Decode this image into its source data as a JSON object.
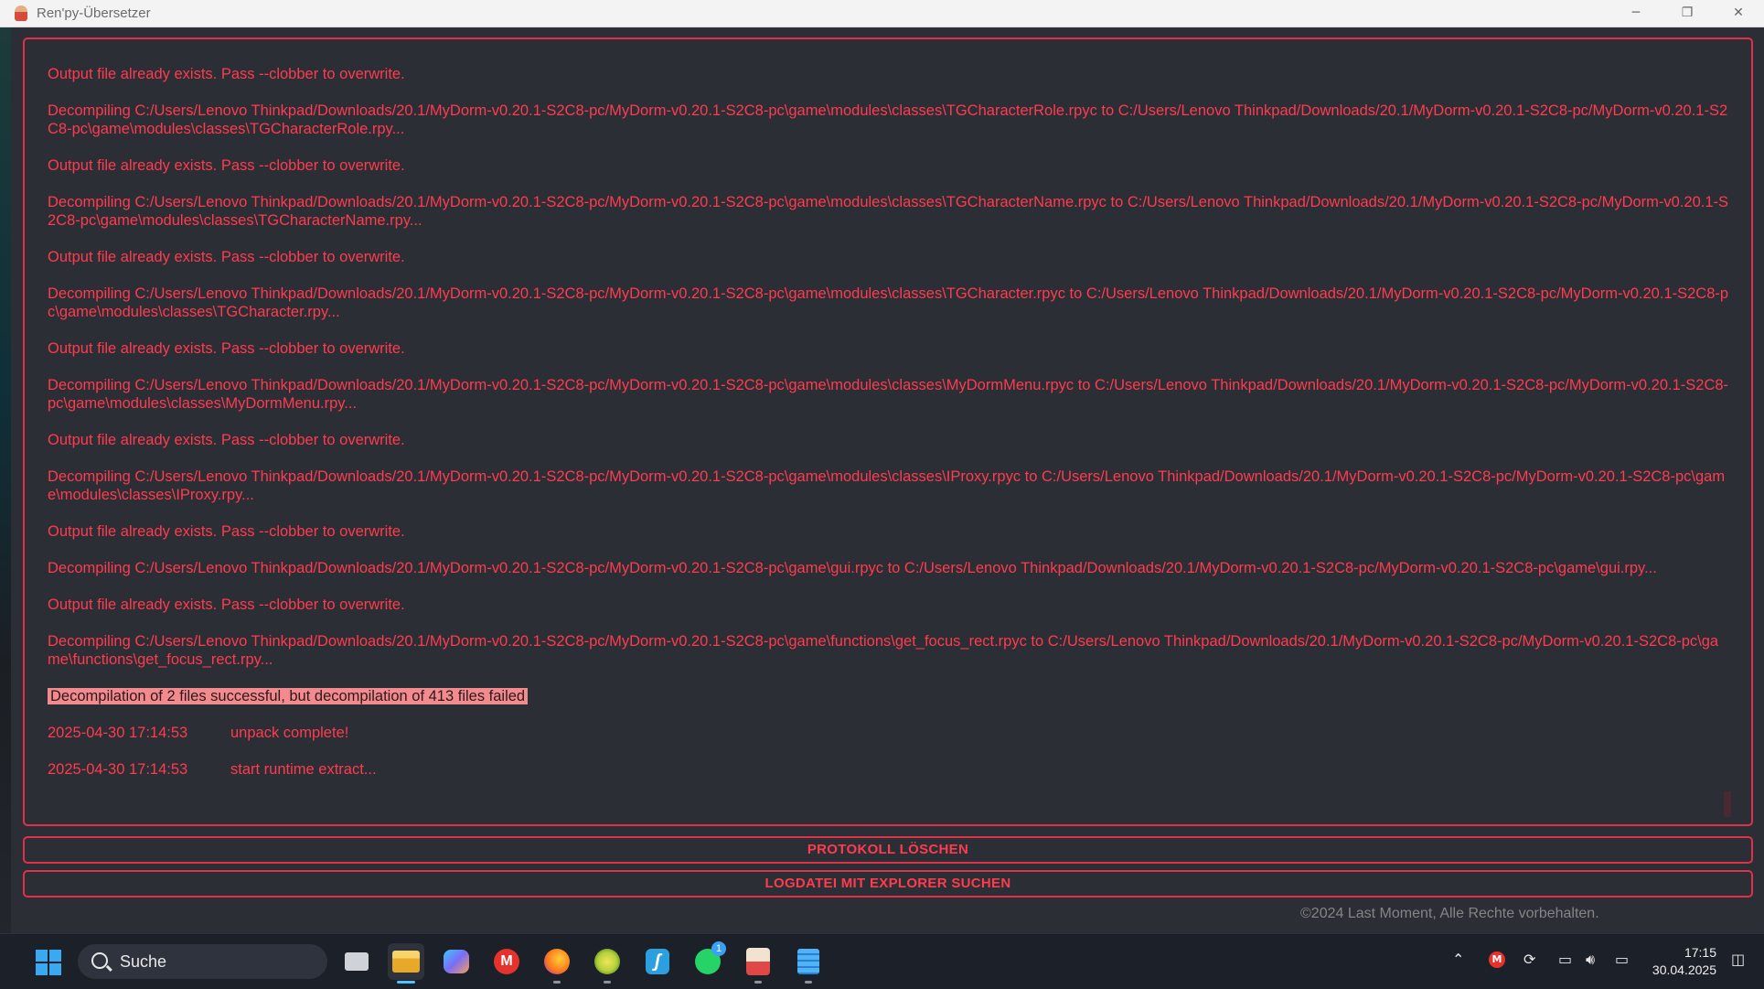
{
  "window": {
    "title": "Ren'py-Übersetzer",
    "minimize_glyph": "─",
    "maximize_glyph": "❐",
    "close_glyph": "✕"
  },
  "log": {
    "lines": [
      {
        "type": "plain",
        "text": "Output file already exists. Pass --clobber to overwrite."
      },
      {
        "type": "plain",
        "text": "Decompiling C:/Users/Lenovo Thinkpad/Downloads/20.1/MyDorm-v0.20.1-S2C8-pc/MyDorm-v0.20.1-S2C8-pc\\game\\modules\\classes\\TGCharacterRole.rpyc to C:/Users/Lenovo Thinkpad/Downloads/20.1/MyDorm-v0.20.1-S2C8-pc/MyDorm-v0.20.1-S2C8-pc\\game\\modules\\classes\\TGCharacterRole.rpy..."
      },
      {
        "type": "plain",
        "text": "Output file already exists. Pass --clobber to overwrite."
      },
      {
        "type": "plain",
        "text": "Decompiling C:/Users/Lenovo Thinkpad/Downloads/20.1/MyDorm-v0.20.1-S2C8-pc/MyDorm-v0.20.1-S2C8-pc\\game\\modules\\classes\\TGCharacterName.rpyc to C:/Users/Lenovo Thinkpad/Downloads/20.1/MyDorm-v0.20.1-S2C8-pc/MyDorm-v0.20.1-S2C8-pc\\game\\modules\\classes\\TGCharacterName.rpy..."
      },
      {
        "type": "plain",
        "text": "Output file already exists. Pass --clobber to overwrite."
      },
      {
        "type": "plain",
        "text": "Decompiling C:/Users/Lenovo Thinkpad/Downloads/20.1/MyDorm-v0.20.1-S2C8-pc/MyDorm-v0.20.1-S2C8-pc\\game\\modules\\classes\\TGCharacter.rpyc to C:/Users/Lenovo Thinkpad/Downloads/20.1/MyDorm-v0.20.1-S2C8-pc/MyDorm-v0.20.1-S2C8-pc\\game\\modules\\classes\\TGCharacter.rpy..."
      },
      {
        "type": "plain",
        "text": "Output file already exists. Pass --clobber to overwrite."
      },
      {
        "type": "plain",
        "text": "Decompiling C:/Users/Lenovo Thinkpad/Downloads/20.1/MyDorm-v0.20.1-S2C8-pc/MyDorm-v0.20.1-S2C8-pc\\game\\modules\\classes\\MyDormMenu.rpyc to C:/Users/Lenovo Thinkpad/Downloads/20.1/MyDorm-v0.20.1-S2C8-pc/MyDorm-v0.20.1-S2C8-pc\\game\\modules\\classes\\MyDormMenu.rpy..."
      },
      {
        "type": "plain",
        "text": "Output file already exists. Pass --clobber to overwrite."
      },
      {
        "type": "plain",
        "text": "Decompiling C:/Users/Lenovo Thinkpad/Downloads/20.1/MyDorm-v0.20.1-S2C8-pc/MyDorm-v0.20.1-S2C8-pc\\game\\modules\\classes\\IProxy.rpyc to C:/Users/Lenovo Thinkpad/Downloads/20.1/MyDorm-v0.20.1-S2C8-pc/MyDorm-v0.20.1-S2C8-pc\\game\\modules\\classes\\IProxy.rpy..."
      },
      {
        "type": "plain",
        "text": "Output file already exists. Pass --clobber to overwrite."
      },
      {
        "type": "plain",
        "text": "Decompiling C:/Users/Lenovo Thinkpad/Downloads/20.1/MyDorm-v0.20.1-S2C8-pc/MyDorm-v0.20.1-S2C8-pc\\game\\gui.rpyc to C:/Users/Lenovo Thinkpad/Downloads/20.1/MyDorm-v0.20.1-S2C8-pc/MyDorm-v0.20.1-S2C8-pc\\game\\gui.rpy..."
      },
      {
        "type": "plain",
        "text": "Output file already exists. Pass --clobber to overwrite."
      },
      {
        "type": "plain",
        "text": "Decompiling C:/Users/Lenovo Thinkpad/Downloads/20.1/MyDorm-v0.20.1-S2C8-pc/MyDorm-v0.20.1-S2C8-pc\\game\\functions\\get_focus_rect.rpyc to C:/Users/Lenovo Thinkpad/Downloads/20.1/MyDorm-v0.20.1-S2C8-pc/MyDorm-v0.20.1-S2C8-pc\\game\\functions\\get_focus_rect.rpy..."
      },
      {
        "type": "highlight",
        "text": "Decompilation of 2 files successful, but decompilation of 413 files failed"
      },
      {
        "type": "timed",
        "time": "2025-04-30 17:14:53",
        "text": "unpack complete!"
      },
      {
        "type": "timed",
        "time": "2025-04-30 17:14:53",
        "text": "start runtime extract..."
      }
    ]
  },
  "buttons": {
    "clear_log": "PROTOKOLL LÖSCHEN",
    "find_logfile": "LOGDATEI MIT EXPLORER SUCHEN"
  },
  "footer": {
    "copyright": "©2024 Last Moment, Alle Rechte vorbehalten."
  },
  "taskbar": {
    "search_label": "Suche",
    "whatsapp_badge": "1",
    "clock_time": "17:15",
    "clock_date": "30.04.2025",
    "apps": [
      {
        "name": "task-view",
        "color": "#cfd3d8"
      },
      {
        "name": "file-explorer",
        "color": "#f4c543"
      },
      {
        "name": "copilot",
        "color": "#7b6cf6"
      },
      {
        "name": "mega",
        "color": "#e5322d"
      },
      {
        "name": "firefox",
        "color": "#ff7a1a"
      },
      {
        "name": "app-green",
        "color": "#b8d33a"
      },
      {
        "name": "app-blue",
        "color": "#2b9fe0"
      },
      {
        "name": "whatsapp",
        "color": "#25d366"
      },
      {
        "name": "renpy-translator",
        "color": "#f2e3d0"
      },
      {
        "name": "notepad",
        "color": "#4fb3f6"
      }
    ]
  }
}
